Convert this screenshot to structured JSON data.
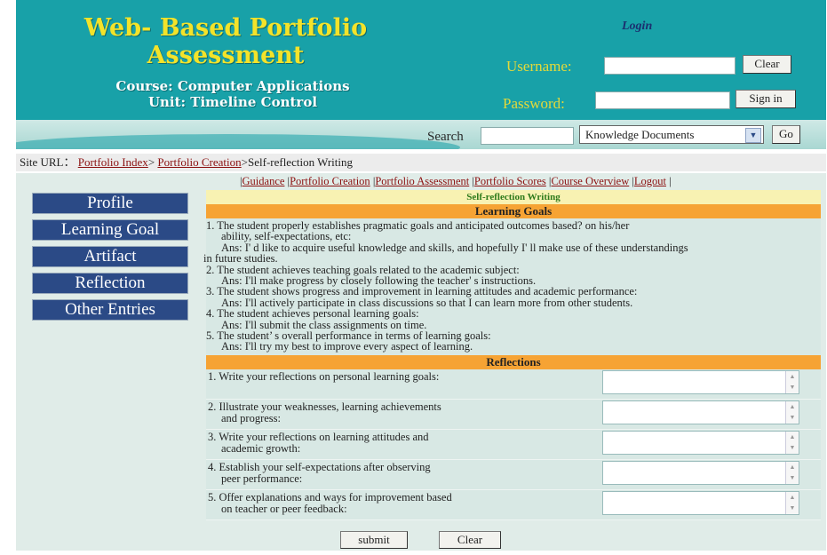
{
  "header": {
    "title": "Web- Based Portfolio\nAssessment",
    "course": "Course: Computer Applications\nUnit: Timeline Control",
    "login_title": "Login",
    "username_label": "Username:",
    "password_label": "Password:",
    "clear_label": "Clear",
    "signin_label": "Sign in"
  },
  "search": {
    "label": "Search",
    "select_value": "Knowledge Documents",
    "go_label": "Go"
  },
  "breadcrumb": {
    "lead": "Site URL：",
    "link1": "Portfolio Index",
    "sep1": "> ",
    "link2": "Portfolio Creation",
    "sep2": ">",
    "current": "Self-reflection Writing"
  },
  "topnav": [
    "Guidance",
    "Portfolio Creation",
    "Portfolio Assessment",
    "Portfolio Scores",
    "Course Overview",
    "Logout"
  ],
  "sidebar": [
    "Profile",
    "Learning Goal",
    "Artifact",
    "Reflection",
    "Other Entries"
  ],
  "content": {
    "title": "Self-reflection Writing",
    "goals_heading": "Learning Goals",
    "goals": [
      {
        "q1": "1. The student properly establishes pragmatic goals and anticipated outcomes based? on his/her",
        "q2": "ability, self-expectations, etc:",
        "a1": "Ans: I' d like to acquire useful knowledge and skills, and hopefully I' ll make use of these understandings",
        "a2": "in future studies."
      },
      {
        "q1": "2. The student achieves teaching goals related to the academic subject:",
        "a1": "Ans: I'll make progress by closely following the teacher' s instructions."
      },
      {
        "q1": "3. The student shows progress and improvement in learning attitudes and academic performance:",
        "a1": "Ans: I'll actively participate in class discussions so that I can learn more from other students."
      },
      {
        "q1": "4. The student achieves personal learning goals:",
        "a1": "Ans: I'll submit the class assignments on time."
      },
      {
        "q1": "5. The student’ s overall performance in terms of learning goals:",
        "a1": "Ans: I'll try my best to improve every aspect of learning."
      }
    ],
    "reflections_heading": "Reflections",
    "reflections": [
      {
        "l1": "1. Write your reflections on personal learning goals:",
        "l2": ""
      },
      {
        "l1": "2. Illustrate your weaknesses, learning achievements",
        "l2": "and progress:"
      },
      {
        "l1": "3. Write your reflections on learning attitudes and",
        "l2": "academic growth:"
      },
      {
        "l1": "4. Establish your self-expectations after observing",
        "l2": "peer performance:"
      },
      {
        "l1": "5. Offer explanations and ways for improvement based",
        "l2": "on teacher or peer feedback:"
      }
    ],
    "submit_label": "submit",
    "clear_label": "Clear"
  }
}
